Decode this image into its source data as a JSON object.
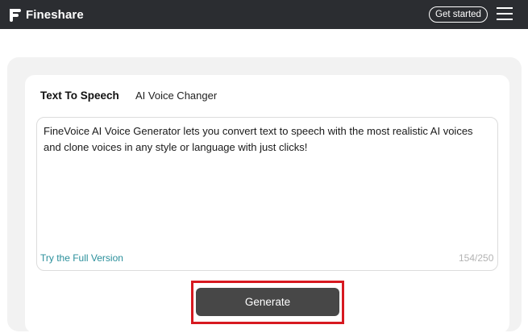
{
  "header": {
    "brand_name": "Fineshare",
    "get_started_label": "Get started"
  },
  "tabs": [
    {
      "label": "Text To Speech",
      "active": true
    },
    {
      "label": "AI Voice Changer",
      "active": false
    }
  ],
  "editor": {
    "text": "FineVoice AI Voice Generator lets you convert text to speech with the most realistic AI voices and clone voices in any style or language with just clicks!",
    "try_full_label": "Try the Full Version",
    "char_count": "154/250"
  },
  "actions": {
    "generate_label": "Generate"
  },
  "colors": {
    "header_bg": "#2b2d31",
    "link_teal": "#2a8f9b",
    "highlight_red": "#d71920",
    "button_bg": "#474747"
  }
}
